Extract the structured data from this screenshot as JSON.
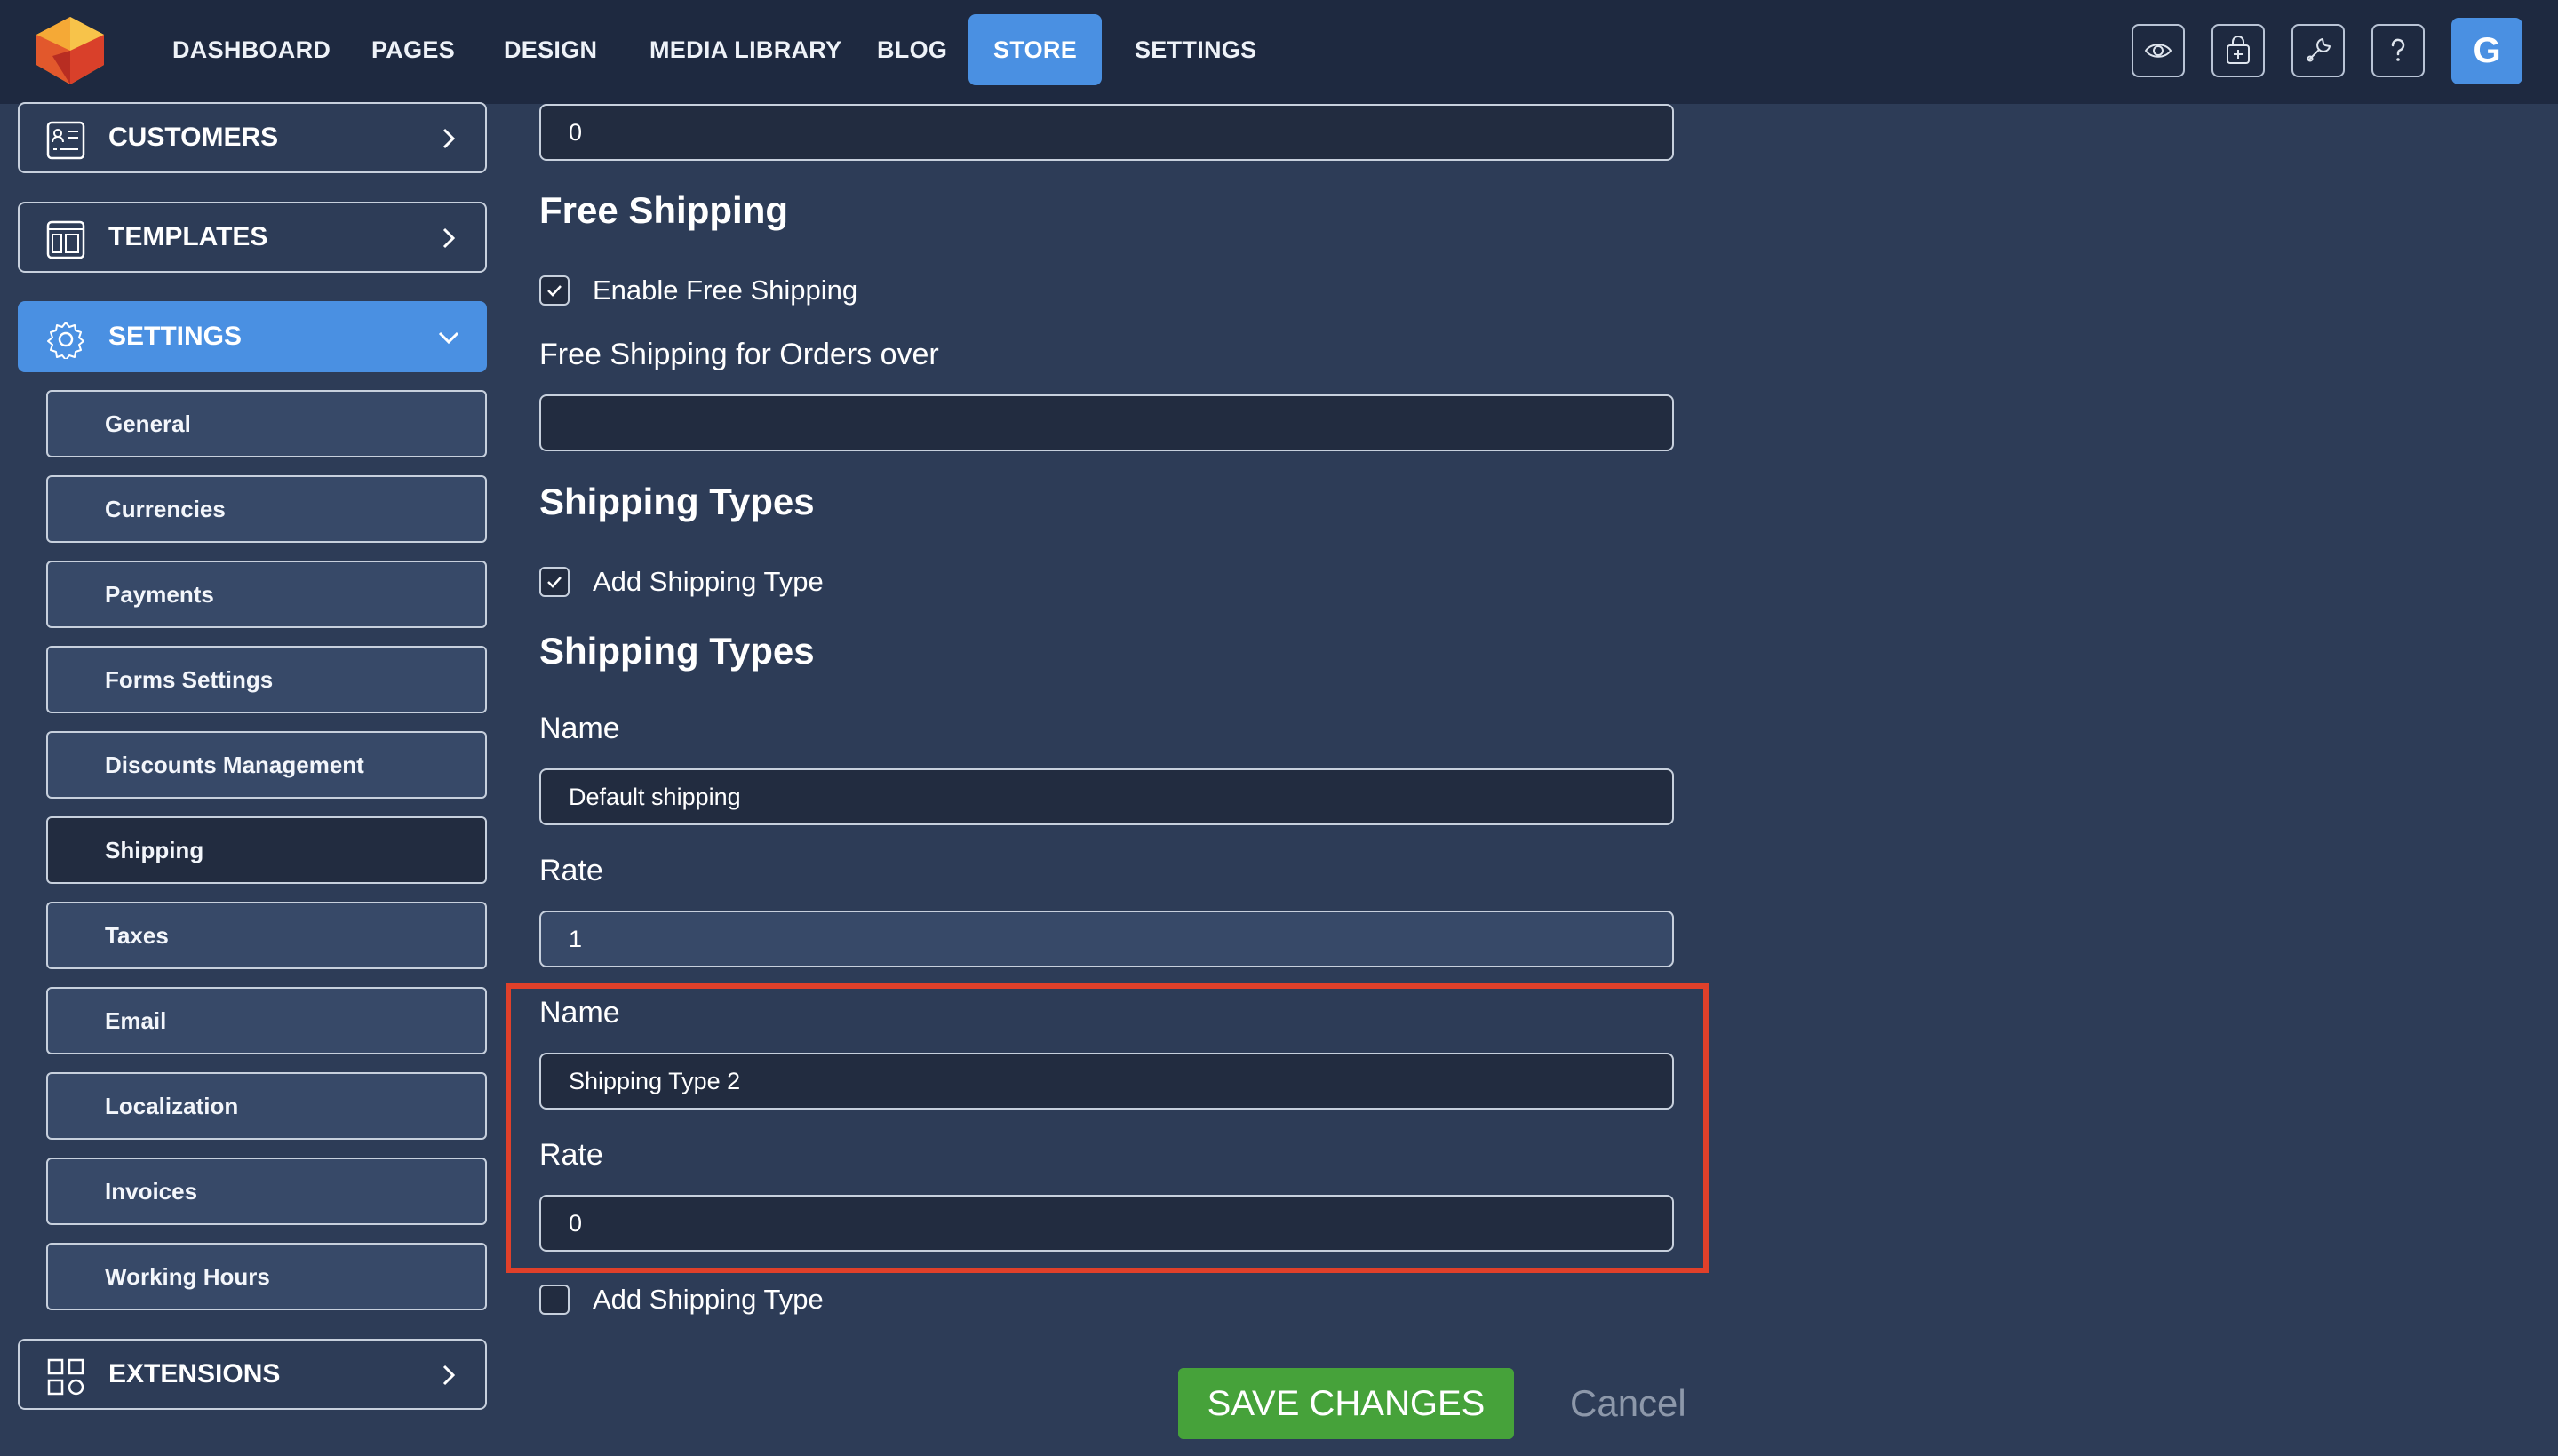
{
  "nav": {
    "items": [
      "DASHBOARD",
      "PAGES",
      "DESIGN",
      "MEDIA LIBRARY",
      "BLOG",
      "STORE",
      "SETTINGS"
    ],
    "active": "STORE",
    "toolbar_icons": [
      "eye-icon",
      "store-bag-icon",
      "wrench-icon",
      "help-icon"
    ],
    "avatar_letter": "G"
  },
  "sidebar": {
    "customers": "CUSTOMERS",
    "templates": "TEMPLATES",
    "settings": "SETTINGS",
    "extensions": "EXTENSIONS",
    "sub_items": [
      "General",
      "Currencies",
      "Payments",
      "Forms Settings",
      "Discounts Management",
      "Shipping",
      "Taxes",
      "Email",
      "Localization",
      "Invoices",
      "Working Hours"
    ],
    "active_sub": "Shipping"
  },
  "main": {
    "top_field_value": "0",
    "free_shipping_heading": "Free Shipping",
    "enable_free_shipping_label": "Enable Free Shipping",
    "enable_free_shipping_checked": true,
    "free_shipping_orders_label": "Free Shipping for Orders over",
    "free_shipping_orders_value": "",
    "shipping_types_heading": "Shipping Types",
    "add_shipping_type_label": "Add Shipping Type",
    "add_shipping_type_checked": true,
    "shipping_types_heading_2": "Shipping Types",
    "types": [
      {
        "name_label": "Name",
        "name_value": "Default shipping",
        "rate_label": "Rate",
        "rate_value": "1"
      },
      {
        "name_label": "Name",
        "name_value": "Shipping Type 2",
        "rate_label": "Rate",
        "rate_value": "0"
      }
    ],
    "add_shipping_type_label_2": "Add Shipping Type",
    "add_shipping_type_2_checked": false,
    "save_label": "SAVE CHANGES",
    "cancel_label": "Cancel"
  },
  "colors": {
    "accent": "#4a90e2",
    "save": "#46a23a",
    "highlight": "#e0402a",
    "background": "#2d3c57",
    "topbar": "#1e2940"
  }
}
